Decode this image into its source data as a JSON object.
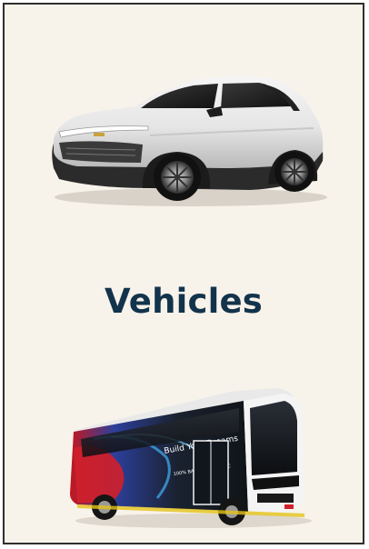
{
  "card": {
    "title": "Vehicles"
  },
  "images": {
    "top": {
      "icon": "electric-suv-image"
    },
    "bottom": {
      "icon": "electric-bus-image",
      "bus_text": "Build Your Dreams",
      "bus_subtext": "100% BATTERY ELECTRIC"
    }
  },
  "colors": {
    "background": "#f7f2ea",
    "title": "#12334b",
    "border": "#2f2f2f"
  }
}
